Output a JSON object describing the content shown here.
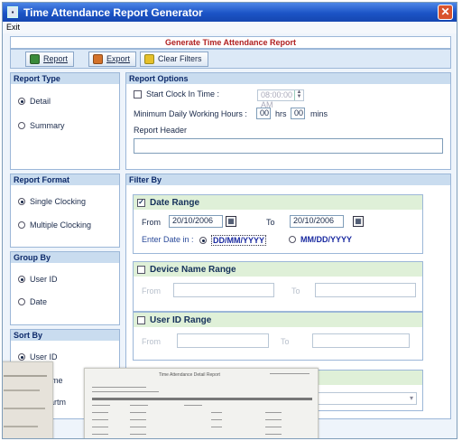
{
  "window": {
    "title": "Time Attendance Report Generator",
    "close_glyph": "✕"
  },
  "menu": {
    "exit": "Exit"
  },
  "header": {
    "title": "Generate Time Attendance Report"
  },
  "toolbar": {
    "report": "Report",
    "export": "Export",
    "clear_filters": "Clear Filters"
  },
  "report_type": {
    "title": "Report Type",
    "detail": "Detail",
    "summary": "Summary",
    "selected": "Detail"
  },
  "report_format": {
    "title": "Report Format",
    "single": "Single Clocking",
    "multiple": "Multiple Clocking",
    "selected": "Single Clocking"
  },
  "group_by": {
    "title": "Group By",
    "user_id": "User ID",
    "date": "Date",
    "selected": "User ID"
  },
  "sort_by": {
    "title": "Sort By",
    "user_id": "User ID",
    "name_partial": "ame",
    "department_partial": "partm",
    "selected": "User ID"
  },
  "report_options": {
    "title": "Report Options",
    "start_clock_label": "Start Clock In Time :",
    "start_clock_value": "08:00:00 AM",
    "min_hours_label": "Minimum Daily Working Hours :",
    "hours_value": "00",
    "hrs_label": "hrs",
    "mins_value": "00",
    "mins_label": "mins",
    "report_header_label": "Report Header"
  },
  "filter_by": {
    "title": "Filter By",
    "date_range": {
      "title": "Date Range",
      "checked": true,
      "from_label": "From",
      "from_value": "20/10/2006",
      "to_label": "To",
      "to_value": "20/10/2006",
      "enter_date_label": "Enter Date in :",
      "format_dd": "DD/MM/YYYY",
      "format_mm": "MM/DD/YYYY",
      "format_selected": "DD/MM/YYYY"
    },
    "device_range": {
      "title": "Device Name Range",
      "from_label": "From",
      "to_label": "To"
    },
    "user_range": {
      "title": "User ID Range",
      "from_label": "From",
      "to_label": "To"
    }
  },
  "preview": {
    "title": "Time Attendance Detail Report"
  },
  "icons": {
    "calendar": "calendar-icon",
    "report": "report-icon",
    "export": "export-icon",
    "clear": "clear-filters-icon"
  }
}
